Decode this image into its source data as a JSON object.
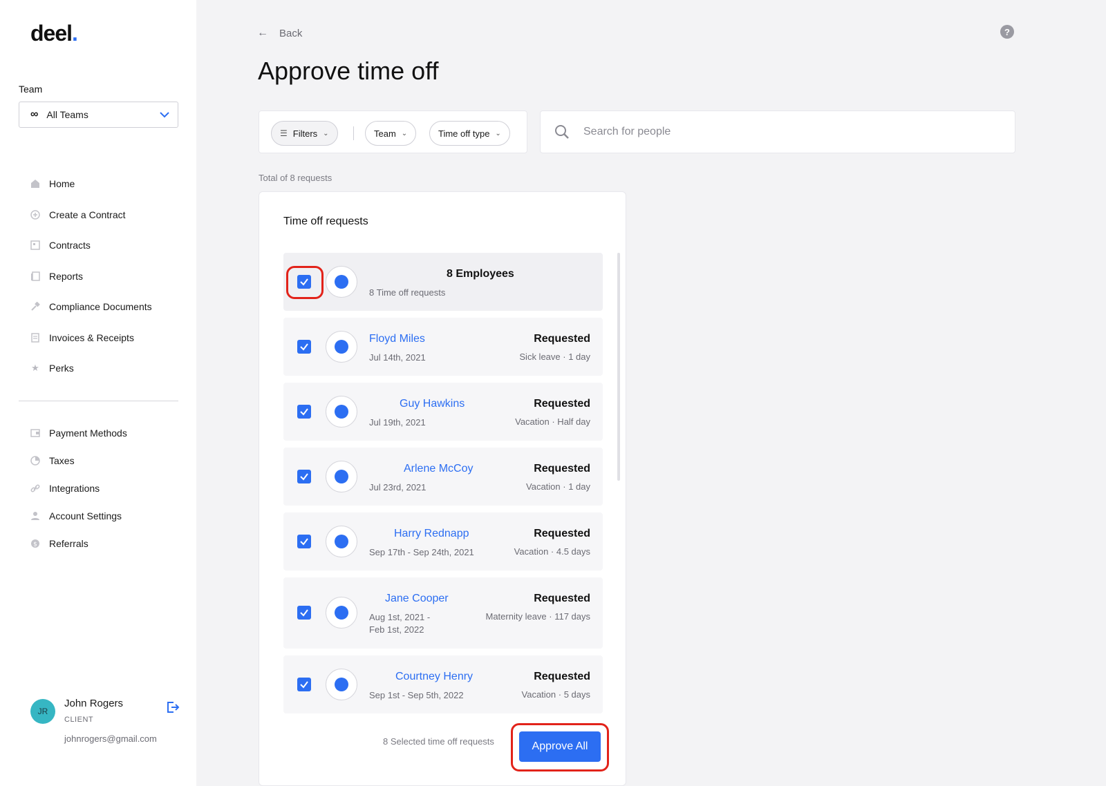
{
  "sidebar": {
    "logo": "deel",
    "team_label": "Team",
    "team_select": "All Teams",
    "nav_main": [
      {
        "label": "Home",
        "icon": "home-icon"
      },
      {
        "label": "Create a Contract",
        "icon": "plus-circle-icon"
      },
      {
        "label": "Contracts",
        "icon": "contract-icon"
      },
      {
        "label": "Reports",
        "icon": "reports-icon"
      },
      {
        "label": "Compliance Documents",
        "icon": "hammer-icon"
      },
      {
        "label": "Invoices & Receipts",
        "icon": "invoice-icon"
      },
      {
        "label": "Perks",
        "icon": "star-icon"
      }
    ],
    "nav_secondary": [
      {
        "label": "Payment Methods",
        "icon": "wallet-icon"
      },
      {
        "label": "Taxes",
        "icon": "pie-chart-icon"
      },
      {
        "label": "Integrations",
        "icon": "link-icon"
      },
      {
        "label": "Account Settings",
        "icon": "user-icon"
      },
      {
        "label": "Referrals",
        "icon": "dollar-icon"
      }
    ],
    "user": {
      "initials": "JR",
      "name": "John Rogers",
      "role": "CLIENT",
      "email": "johnrogers@gmail.com"
    }
  },
  "header": {
    "back_label": "Back",
    "title": "Approve time off",
    "help": "?"
  },
  "filters": {
    "filters_label": "Filters",
    "team_label": "Team",
    "type_label": "Time off type",
    "search_placeholder": "Search for people"
  },
  "summary": {
    "total": "Total of 8 requests"
  },
  "requests": {
    "title": "Time off requests",
    "head": {
      "title": "8 Employees",
      "subtitle": "8 Time off requests"
    },
    "items": [
      {
        "name": "Floyd Miles",
        "date": "Jul 14th, 2021",
        "date2": "",
        "status": "Requested",
        "detail": "Sick leave · 1 day"
      },
      {
        "name": "Guy Hawkins",
        "date": "Jul 19th, 2021",
        "date2": "",
        "status": "Requested",
        "detail": "Vacation · Half day"
      },
      {
        "name": "Arlene McCoy",
        "date": "Jul 23rd, 2021",
        "date2": "",
        "status": "Requested",
        "detail": "Vacation · 1 day"
      },
      {
        "name": "Harry Rednapp",
        "date": "Sep 17th - Sep 24th, 2021",
        "date2": "",
        "status": "Requested",
        "detail": "Vacation · 4.5 days"
      },
      {
        "name": "Jane Cooper",
        "date": "Aug 1st, 2021 -",
        "date2": "Feb 1st, 2022",
        "status": "Requested",
        "detail": "Maternity leave · 117 days"
      },
      {
        "name": "Courtney Henry",
        "date": "Sep 1st - Sep 5th, 2022",
        "date2": "",
        "status": "Requested",
        "detail": "Vacation · 5 days"
      }
    ],
    "selected_text": "8 Selected time off requests",
    "approve_label": "Approve All"
  },
  "colors": {
    "accent": "#2c6ef2",
    "highlight": "#e2231a"
  }
}
